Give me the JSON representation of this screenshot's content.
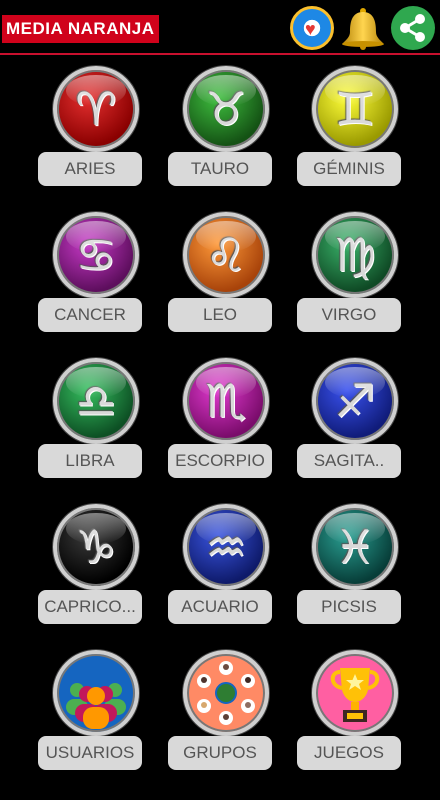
{
  "header": {
    "title": "MEDIA NARANJA",
    "icons": [
      "zodiac-wheel-icon",
      "bell-icon",
      "share-icon"
    ]
  },
  "colors": {
    "aries": "#a00000",
    "tauro": "#1f7a1f",
    "geminis": "#d4d400",
    "cancer": "#8e1b8e",
    "leo": "#e36a0e",
    "virgo": "#1e7a3c",
    "libra": "#1c8a3a",
    "escorpio": "#b0179b",
    "sagitario": "#1f2fb0",
    "capricornio": "#111111",
    "acuario": "#1a2f9a",
    "piscis": "#0f6b63",
    "usuarios": "#1565c0",
    "grupos": "#ff8a65",
    "juegos": "#ff5fa2",
    "label_bg": "#d9d9d9",
    "title_bg": "#d0021b",
    "share": "#2fa84f"
  },
  "tiles": [
    {
      "label": "ARIES",
      "icon": "aries-icon",
      "glyph": "♈"
    },
    {
      "label": "TAURO",
      "icon": "taurus-icon",
      "glyph": "♉"
    },
    {
      "label": "GÉMINIS",
      "icon": "gemini-icon",
      "glyph": "♊"
    },
    {
      "label": "CANCER",
      "icon": "cancer-icon",
      "glyph": "♋"
    },
    {
      "label": "LEO",
      "icon": "leo-icon",
      "glyph": "♌"
    },
    {
      "label": "VIRGO",
      "icon": "virgo-icon",
      "glyph": "♍"
    },
    {
      "label": "LIBRA",
      "icon": "libra-icon",
      "glyph": "♎"
    },
    {
      "label": "ESCORPIO",
      "icon": "scorpio-icon",
      "glyph": "♏"
    },
    {
      "label": "SAGITA..",
      "icon": "sagittarius-icon",
      "glyph": "♐"
    },
    {
      "label": "CAPRICO...",
      "icon": "capricorn-icon",
      "glyph": "♑"
    },
    {
      "label": "ACUARIO",
      "icon": "aquarius-icon",
      "glyph": "♒"
    },
    {
      "label": "PICSIS",
      "icon": "pisces-icon",
      "glyph": "♓"
    },
    {
      "label": "USUARIOS",
      "icon": "users-icon",
      "glyph": ""
    },
    {
      "label": "GRUPOS",
      "icon": "groups-icon",
      "glyph": ""
    },
    {
      "label": "JUEGOS",
      "icon": "trophy-icon",
      "glyph": ""
    }
  ]
}
